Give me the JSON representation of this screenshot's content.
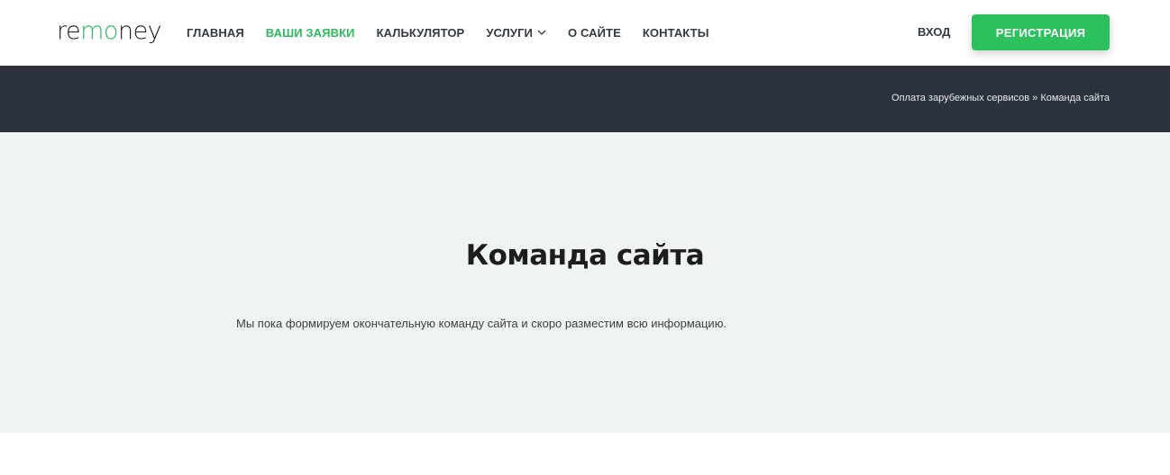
{
  "header": {
    "logo": {
      "prefix": "re",
      "accent": "mo",
      "suffix": "ney"
    },
    "nav": [
      {
        "label": "ГЛАВНАЯ",
        "active": false
      },
      {
        "label": "ВАШИ ЗАЯВКИ",
        "active": true
      },
      {
        "label": "КАЛЬКУЛЯТОР",
        "active": false
      },
      {
        "label": "УСЛУГИ",
        "active": false,
        "dropdown": true
      },
      {
        "label": "О САЙТЕ",
        "active": false
      },
      {
        "label": "КОНТАКТЫ",
        "active": false
      }
    ],
    "login_label": "ВХОД",
    "register_label": "РЕГИСТРАЦИЯ"
  },
  "breadcrumb": {
    "parent": "Оплата зарубежных сервисов",
    "separator": "»",
    "current": "Команда сайта"
  },
  "main": {
    "title": "Команда сайта",
    "text": "Мы пока формируем окончательную команду сайта и скоро разместим всю информацию."
  },
  "colors": {
    "accent": "#2cc15d",
    "dark_band": "#2c333d",
    "content_bg": "#f0f3f4",
    "nav_text": "#333a42"
  }
}
